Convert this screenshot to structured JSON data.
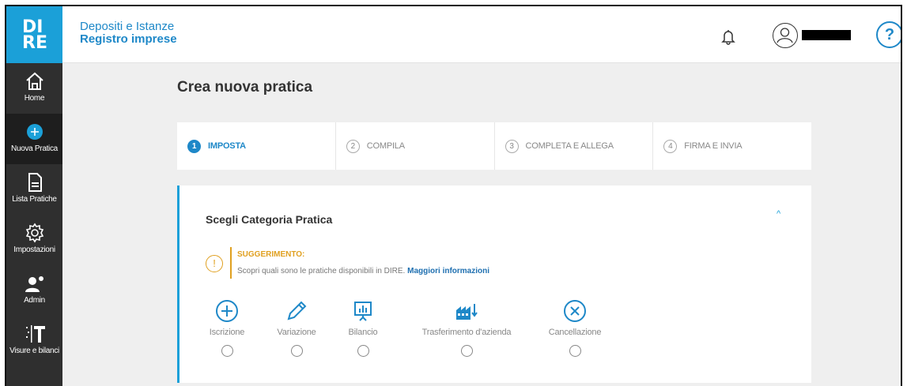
{
  "sidebar": {
    "logo": {
      "line1": "DI",
      "line2": "RE"
    },
    "items": [
      {
        "label": "Home",
        "icon": "home-icon"
      },
      {
        "label": "Nuova Pratica",
        "icon": "plus-circle-icon"
      },
      {
        "label": "Lista Pratiche",
        "icon": "document-list-icon"
      },
      {
        "label": "Impostazioni",
        "icon": "gear-icon"
      },
      {
        "label": "Admin",
        "icon": "user-gear-icon"
      },
      {
        "label": "Visure e bilanci",
        "icon": "visure-icon"
      }
    ]
  },
  "header": {
    "brand_line1": "Depositi e Istanze",
    "brand_line2": "Registro imprese",
    "help": "?"
  },
  "main": {
    "title": "Crea nuova pratica",
    "steps": [
      {
        "num": "1",
        "label": "IMPOSTA",
        "active": true
      },
      {
        "num": "2",
        "label": "COMPILA",
        "active": false
      },
      {
        "num": "3",
        "label": "COMPLETA E ALLEGA",
        "active": false
      },
      {
        "num": "4",
        "label": "FIRMA E INVIA",
        "active": false
      }
    ],
    "card": {
      "title": "Scegli Categoria Pratica",
      "collapse_icon": "^",
      "hint": {
        "icon": "!",
        "title": "SUGGERIMENTO:",
        "text": "Scopri quali sono le pratiche disponibili in DIRE.",
        "link": "Maggiori informazioni"
      },
      "categories": [
        {
          "label": "Iscrizione",
          "icon": "plus-circle-icon"
        },
        {
          "label": "Variazione",
          "icon": "pencil-icon"
        },
        {
          "label": "Bilancio",
          "icon": "chart-board-icon"
        },
        {
          "label": "Trasferimento d'azienda",
          "icon": "factory-transfer-icon"
        },
        {
          "label": "Cancellazione",
          "icon": "x-circle-icon"
        }
      ]
    }
  },
  "colors": {
    "accent": "#1ba0d8",
    "link": "#1e88c8",
    "warning": "#e0a020",
    "sidebar": "#2f2f2f"
  }
}
